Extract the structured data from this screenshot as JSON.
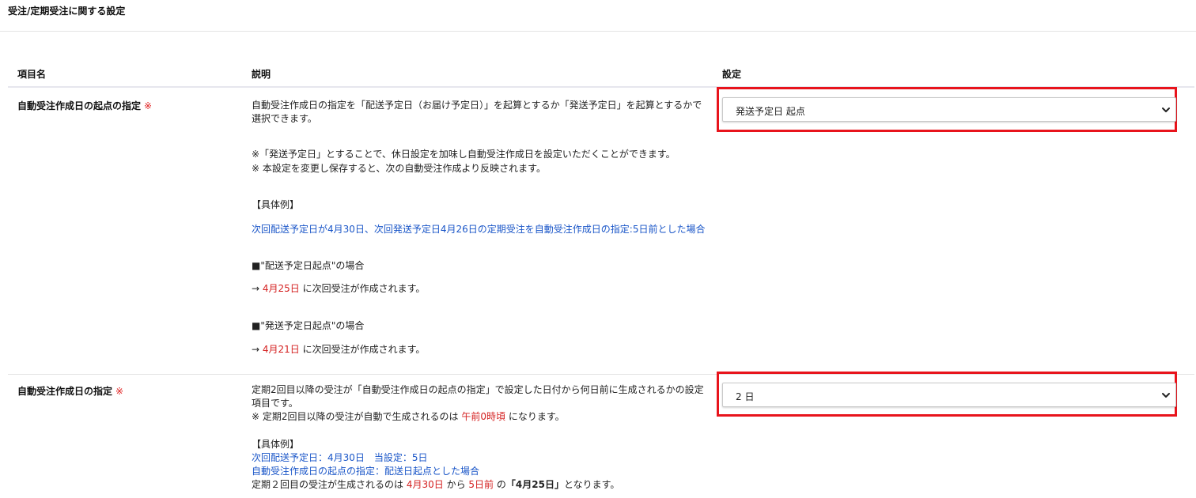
{
  "page": {
    "title": "受注/定期受注に関する設定"
  },
  "table": {
    "headers": {
      "item": "項目名",
      "description": "説明",
      "setting": "設定"
    }
  },
  "rows": [
    {
      "label": "自動受注作成日の起点の指定",
      "required_mark": "※",
      "desc": {
        "main": "自動受注作成日の指定を「配送予定日（お届け予定日）」を起算とするか「発送予定日」を起算とするかで選択できます。",
        "note1": "※「発送予定日」とすることで、休日設定を加味し自動受注作成日を設定いただくことができます。",
        "note2": "※ 本設定を変更し保存すると、次の自動受注作成より反映されます。",
        "example_heading": "【具体例】",
        "example_line": "次回配送予定日が4月30日、次回発送予定日4月26日の定期受注を自動受注作成日の指定:5日前とした場合",
        "case1_title": "■\"配送予定日起点\"の場合",
        "case1_arrow": "→",
        "case1_date": "4月25日",
        "case1_suffix": "に次回受注が作成されます。",
        "case2_title": "■\"発送予定日起点\"の場合",
        "case2_arrow": "→",
        "case2_date": "4月21日",
        "case2_suffix": "に次回受注が作成されます。"
      },
      "select_value": "発送予定日 起点"
    },
    {
      "label": "自動受注作成日の指定",
      "required_mark": "※",
      "desc": {
        "main": "定期2回目以降の受注が「自動受注作成日の起点の指定」で設定した日付から何日前に生成されるかの設定項目です。",
        "note_prefix": "※ 定期2回目以降の受注が自動で生成されるのは",
        "note_time": "午前0時頃",
        "note_suffix": "になります。",
        "example_heading": "【具体例】",
        "example_line1": "次回配送予定日：4月30日　当設定：5日",
        "example_line2": "自動受注作成日の起点の指定：配送日起点とした場合",
        "result_prefix": "定期２回目の受注が生成されるのは",
        "result_date": "4月30日",
        "result_mid": "から",
        "result_days": "5日前",
        "result_no": "の",
        "result_final": "「4月25日」",
        "result_suffix": "となります。"
      },
      "select_value": "2 日"
    }
  ],
  "icons": {
    "select_arrow": "chevron-down-icon"
  },
  "colors": {
    "highlight": "#e8141c",
    "link_blue": "#1a56c8",
    "emphasis_red": "#d42020"
  }
}
